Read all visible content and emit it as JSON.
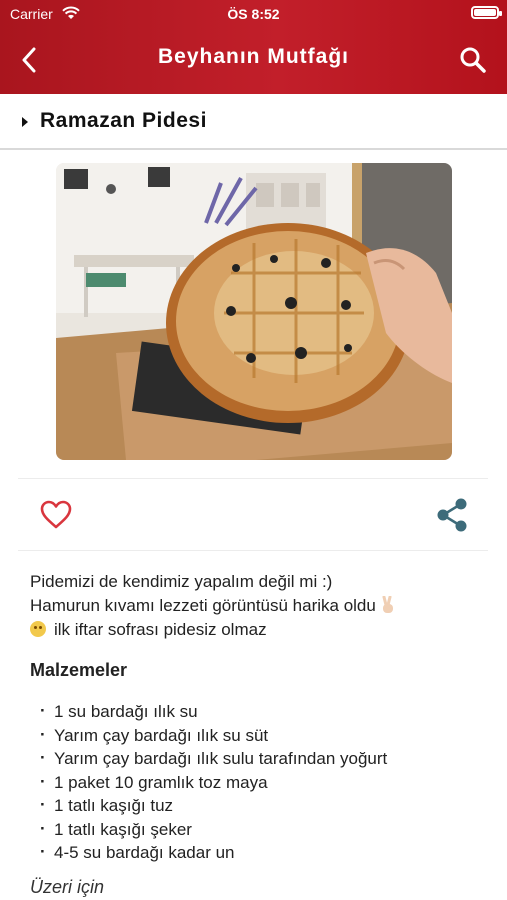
{
  "status_bar": {
    "carrier": "Carrier",
    "time": "ÖS 8:52",
    "battery_level": 1.0
  },
  "header": {
    "title": "Beyhanın Mutfağı",
    "back_icon": "chevron-left-icon",
    "search_icon": "search-icon"
  },
  "section": {
    "title": "Ramazan Pidesi",
    "icon": "caret-right-icon"
  },
  "photo": {
    "alt": "Ramazan pidesi photo"
  },
  "actions": {
    "like_icon": "heart-outline-icon",
    "share_icon": "share-icon",
    "accent_color": "#d9363e",
    "share_color": "#3d6b7a"
  },
  "description": {
    "line1": "Pidemizi de kendimiz yapalım değil mi :)",
    "line2": "Hamurun kıvamı lezzeti görüntüsü harika oldu",
    "line3": "ilk iftar sofrası pidesiz olmaz"
  },
  "ingredients": {
    "title": "Malzemeler",
    "items": [
      "1 su bardağı ılık su",
      "Yarım çay bardağı ılık su süt",
      "Yarım çay bardağı ılık sulu tarafından yoğurt",
      "1 paket 10 gramlık toz maya",
      "1 tatlı kaşığı tuz",
      "1 tatlı kaşığı şeker",
      "4-5 su bardağı kadar un"
    ]
  },
  "topping": {
    "title": "Üzeri için"
  },
  "colors": {
    "header": "#b71922",
    "text": "#222222"
  }
}
